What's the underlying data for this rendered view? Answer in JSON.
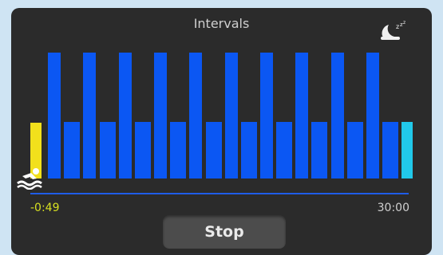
{
  "header": {
    "title": "Intervals",
    "sleep_icon": "sleep-icon"
  },
  "colors": {
    "work": "#0b57f3",
    "rest": "#0b57f3",
    "warmup": "#f2e01c",
    "cooldown": "#21c9ea"
  },
  "intervals": [
    {
      "type": "warmup",
      "level": 0.44
    },
    {
      "type": "work",
      "level": 1.0
    },
    {
      "type": "rest",
      "level": 0.45
    },
    {
      "type": "work",
      "level": 1.0
    },
    {
      "type": "rest",
      "level": 0.45
    },
    {
      "type": "work",
      "level": 1.0
    },
    {
      "type": "rest",
      "level": 0.45
    },
    {
      "type": "work",
      "level": 1.0
    },
    {
      "type": "rest",
      "level": 0.45
    },
    {
      "type": "work",
      "level": 1.0
    },
    {
      "type": "rest",
      "level": 0.45
    },
    {
      "type": "work",
      "level": 1.0
    },
    {
      "type": "rest",
      "level": 0.45
    },
    {
      "type": "work",
      "level": 1.0
    },
    {
      "type": "rest",
      "level": 0.45
    },
    {
      "type": "work",
      "level": 1.0
    },
    {
      "type": "rest",
      "level": 0.45
    },
    {
      "type": "work",
      "level": 1.0
    },
    {
      "type": "rest",
      "level": 0.45
    },
    {
      "type": "work",
      "level": 1.0
    },
    {
      "type": "rest",
      "level": 0.45
    },
    {
      "type": "cooldown",
      "level": 0.45
    }
  ],
  "timeline": {
    "elapsed": "-0:49",
    "total": "30:00",
    "swimmer_icon": "swimmer-icon"
  },
  "controls": {
    "stop_label": "Stop"
  }
}
